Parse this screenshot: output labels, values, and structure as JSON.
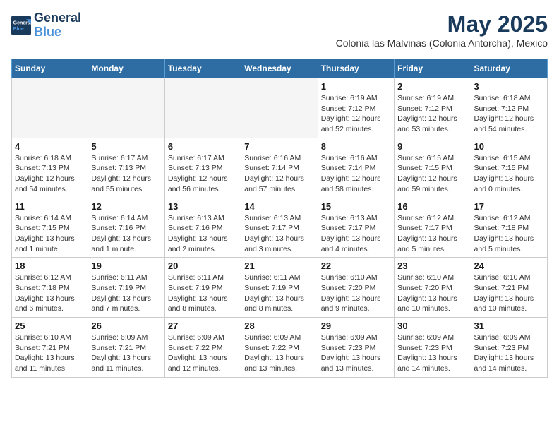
{
  "header": {
    "logo_line1": "General",
    "logo_line2": "Blue",
    "month_title": "May 2025",
    "subtitle": "Colonia las Malvinas (Colonia Antorcha), Mexico"
  },
  "weekdays": [
    "Sunday",
    "Monday",
    "Tuesday",
    "Wednesday",
    "Thursday",
    "Friday",
    "Saturday"
  ],
  "weeks": [
    [
      {
        "day": "",
        "detail": "",
        "empty": true
      },
      {
        "day": "",
        "detail": "",
        "empty": true
      },
      {
        "day": "",
        "detail": "",
        "empty": true
      },
      {
        "day": "",
        "detail": "",
        "empty": true
      },
      {
        "day": "1",
        "detail": "Sunrise: 6:19 AM\nSunset: 7:12 PM\nDaylight: 12 hours\nand 52 minutes."
      },
      {
        "day": "2",
        "detail": "Sunrise: 6:19 AM\nSunset: 7:12 PM\nDaylight: 12 hours\nand 53 minutes."
      },
      {
        "day": "3",
        "detail": "Sunrise: 6:18 AM\nSunset: 7:12 PM\nDaylight: 12 hours\nand 54 minutes."
      }
    ],
    [
      {
        "day": "4",
        "detail": "Sunrise: 6:18 AM\nSunset: 7:13 PM\nDaylight: 12 hours\nand 54 minutes."
      },
      {
        "day": "5",
        "detail": "Sunrise: 6:17 AM\nSunset: 7:13 PM\nDaylight: 12 hours\nand 55 minutes."
      },
      {
        "day": "6",
        "detail": "Sunrise: 6:17 AM\nSunset: 7:13 PM\nDaylight: 12 hours\nand 56 minutes."
      },
      {
        "day": "7",
        "detail": "Sunrise: 6:16 AM\nSunset: 7:14 PM\nDaylight: 12 hours\nand 57 minutes."
      },
      {
        "day": "8",
        "detail": "Sunrise: 6:16 AM\nSunset: 7:14 PM\nDaylight: 12 hours\nand 58 minutes."
      },
      {
        "day": "9",
        "detail": "Sunrise: 6:15 AM\nSunset: 7:15 PM\nDaylight: 12 hours\nand 59 minutes."
      },
      {
        "day": "10",
        "detail": "Sunrise: 6:15 AM\nSunset: 7:15 PM\nDaylight: 13 hours\nand 0 minutes."
      }
    ],
    [
      {
        "day": "11",
        "detail": "Sunrise: 6:14 AM\nSunset: 7:15 PM\nDaylight: 13 hours\nand 1 minute."
      },
      {
        "day": "12",
        "detail": "Sunrise: 6:14 AM\nSunset: 7:16 PM\nDaylight: 13 hours\nand 1 minute."
      },
      {
        "day": "13",
        "detail": "Sunrise: 6:13 AM\nSunset: 7:16 PM\nDaylight: 13 hours\nand 2 minutes."
      },
      {
        "day": "14",
        "detail": "Sunrise: 6:13 AM\nSunset: 7:17 PM\nDaylight: 13 hours\nand 3 minutes."
      },
      {
        "day": "15",
        "detail": "Sunrise: 6:13 AM\nSunset: 7:17 PM\nDaylight: 13 hours\nand 4 minutes."
      },
      {
        "day": "16",
        "detail": "Sunrise: 6:12 AM\nSunset: 7:17 PM\nDaylight: 13 hours\nand 5 minutes."
      },
      {
        "day": "17",
        "detail": "Sunrise: 6:12 AM\nSunset: 7:18 PM\nDaylight: 13 hours\nand 5 minutes."
      }
    ],
    [
      {
        "day": "18",
        "detail": "Sunrise: 6:12 AM\nSunset: 7:18 PM\nDaylight: 13 hours\nand 6 minutes."
      },
      {
        "day": "19",
        "detail": "Sunrise: 6:11 AM\nSunset: 7:19 PM\nDaylight: 13 hours\nand 7 minutes."
      },
      {
        "day": "20",
        "detail": "Sunrise: 6:11 AM\nSunset: 7:19 PM\nDaylight: 13 hours\nand 8 minutes."
      },
      {
        "day": "21",
        "detail": "Sunrise: 6:11 AM\nSunset: 7:19 PM\nDaylight: 13 hours\nand 8 minutes."
      },
      {
        "day": "22",
        "detail": "Sunrise: 6:10 AM\nSunset: 7:20 PM\nDaylight: 13 hours\nand 9 minutes."
      },
      {
        "day": "23",
        "detail": "Sunrise: 6:10 AM\nSunset: 7:20 PM\nDaylight: 13 hours\nand 10 minutes."
      },
      {
        "day": "24",
        "detail": "Sunrise: 6:10 AM\nSunset: 7:21 PM\nDaylight: 13 hours\nand 10 minutes."
      }
    ],
    [
      {
        "day": "25",
        "detail": "Sunrise: 6:10 AM\nSunset: 7:21 PM\nDaylight: 13 hours\nand 11 minutes."
      },
      {
        "day": "26",
        "detail": "Sunrise: 6:09 AM\nSunset: 7:21 PM\nDaylight: 13 hours\nand 11 minutes."
      },
      {
        "day": "27",
        "detail": "Sunrise: 6:09 AM\nSunset: 7:22 PM\nDaylight: 13 hours\nand 12 minutes."
      },
      {
        "day": "28",
        "detail": "Sunrise: 6:09 AM\nSunset: 7:22 PM\nDaylight: 13 hours\nand 13 minutes."
      },
      {
        "day": "29",
        "detail": "Sunrise: 6:09 AM\nSunset: 7:23 PM\nDaylight: 13 hours\nand 13 minutes."
      },
      {
        "day": "30",
        "detail": "Sunrise: 6:09 AM\nSunset: 7:23 PM\nDaylight: 13 hours\nand 14 minutes."
      },
      {
        "day": "31",
        "detail": "Sunrise: 6:09 AM\nSunset: 7:23 PM\nDaylight: 13 hours\nand 14 minutes."
      }
    ]
  ]
}
